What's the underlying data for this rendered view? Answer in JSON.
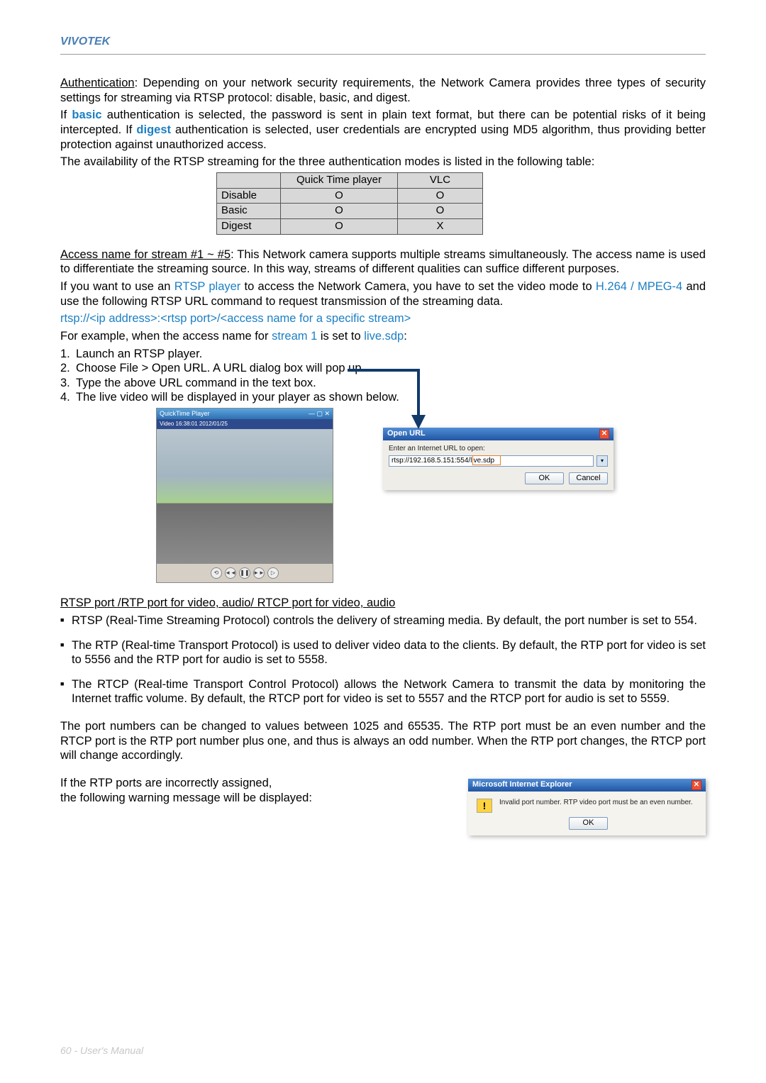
{
  "brand": "VIVOTEK",
  "auth_para": {
    "lead": "Authentication",
    "text": ": Depending on your network security requirements, the Network Camera provides three types of security settings for streaming via RTSP protocol: disable, basic, and digest."
  },
  "auth_para2a": "If ",
  "auth_basic": "basic",
  "auth_para2b": " authentication is selected, the password is sent in plain text format, but there can be potential risks of it being intercepted. If ",
  "auth_digest": "digest",
  "auth_para2c": " authentication is selected, user credentials are encrypted using MD5 algorithm, thus providing better protection against unauthorized access.",
  "auth_para3": "The availability of the RTSP streaming for the three authentication modes is listed in the following table:",
  "table": {
    "h_qt": "Quick Time player",
    "h_vlc": "VLC",
    "rows": [
      {
        "label": "Disable",
        "qt": "O",
        "vlc": "O"
      },
      {
        "label": "Basic",
        "qt": "O",
        "vlc": "O"
      },
      {
        "label": "Digest",
        "qt": "O",
        "vlc": "X"
      }
    ]
  },
  "access": {
    "lead": "Access name for stream #1 ~ #5",
    "text": ": This Network camera supports multiple streams simultaneously. The access name is used to differentiate the streaming source. In this way, streams of different qualities can suffice different purposes.",
    "p2a": "If you want to use an ",
    "rtsp_player": "RTSP player",
    "p2b": " to access the Network Camera, you have to set the video mode to ",
    "codec": "H.264 / MPEG-4",
    "p2c": " and use the following RTSP URL command to request transmission of the streaming data.",
    "url_tpl": "rtsp://<ip address>:<rtsp port>/<access name for a specific stream>",
    "p3a": "For example, when the access name for ",
    "stream1": "stream 1",
    "p3b": " is set to ",
    "live_sdp": "live.sdp",
    "p3c": ":",
    "steps": [
      "Launch an RTSP player.",
      "Choose File > Open URL. A URL dialog box will pop up.",
      "Type the above URL command in the text box.",
      "The live video will be displayed in your player as shown below."
    ]
  },
  "player": {
    "title": "QuickTime Player",
    "strip": "Video 16:38:01 2012/01/25",
    "controls": [
      "⟲",
      "◄◄",
      "❚❚",
      "►►",
      "▷"
    ]
  },
  "openurl": {
    "title": "Open URL",
    "label": "Enter an Internet URL to open:",
    "value": "rtsp://192.168.5.151:554/live.sdp",
    "ok": "OK",
    "cancel": "Cancel"
  },
  "ports": {
    "heading": "RTSP port /RTP port for video, audio/ RTCP port for video, audio",
    "b1": "RTSP (Real-Time Streaming Protocol) controls the delivery of streaming media. By default, the port number is set to 554.",
    "b2": "The RTP (Real-time Transport Protocol) is used to deliver video data to the clients. By default, the RTP port for video is set to 5556 and the RTP port for audio is set to 5558.",
    "b3": "The RTCP (Real-time Transport Control Protocol) allows the Network Camera to transmit the data by monitoring the Internet traffic volume. By default, the RTCP port for video is set to 5557 and the RTCP port for audio is set to 5559.",
    "p_after": "The port numbers can be changed to values between 1025 and 65535. The RTP port must be an even number and the RTCP port is the RTP port number plus one, and thus is always an odd number. When the RTP port changes, the RTCP port will change accordingly.",
    "warn_a": "If the RTP ports are incorrectly assigned,",
    "warn_b": "the following warning message will be displayed:"
  },
  "ie": {
    "title": "Microsoft Internet Explorer",
    "msg": "Invalid port number. RTP video port must be an even number.",
    "ok": "OK"
  },
  "footer": "60 - User's Manual"
}
